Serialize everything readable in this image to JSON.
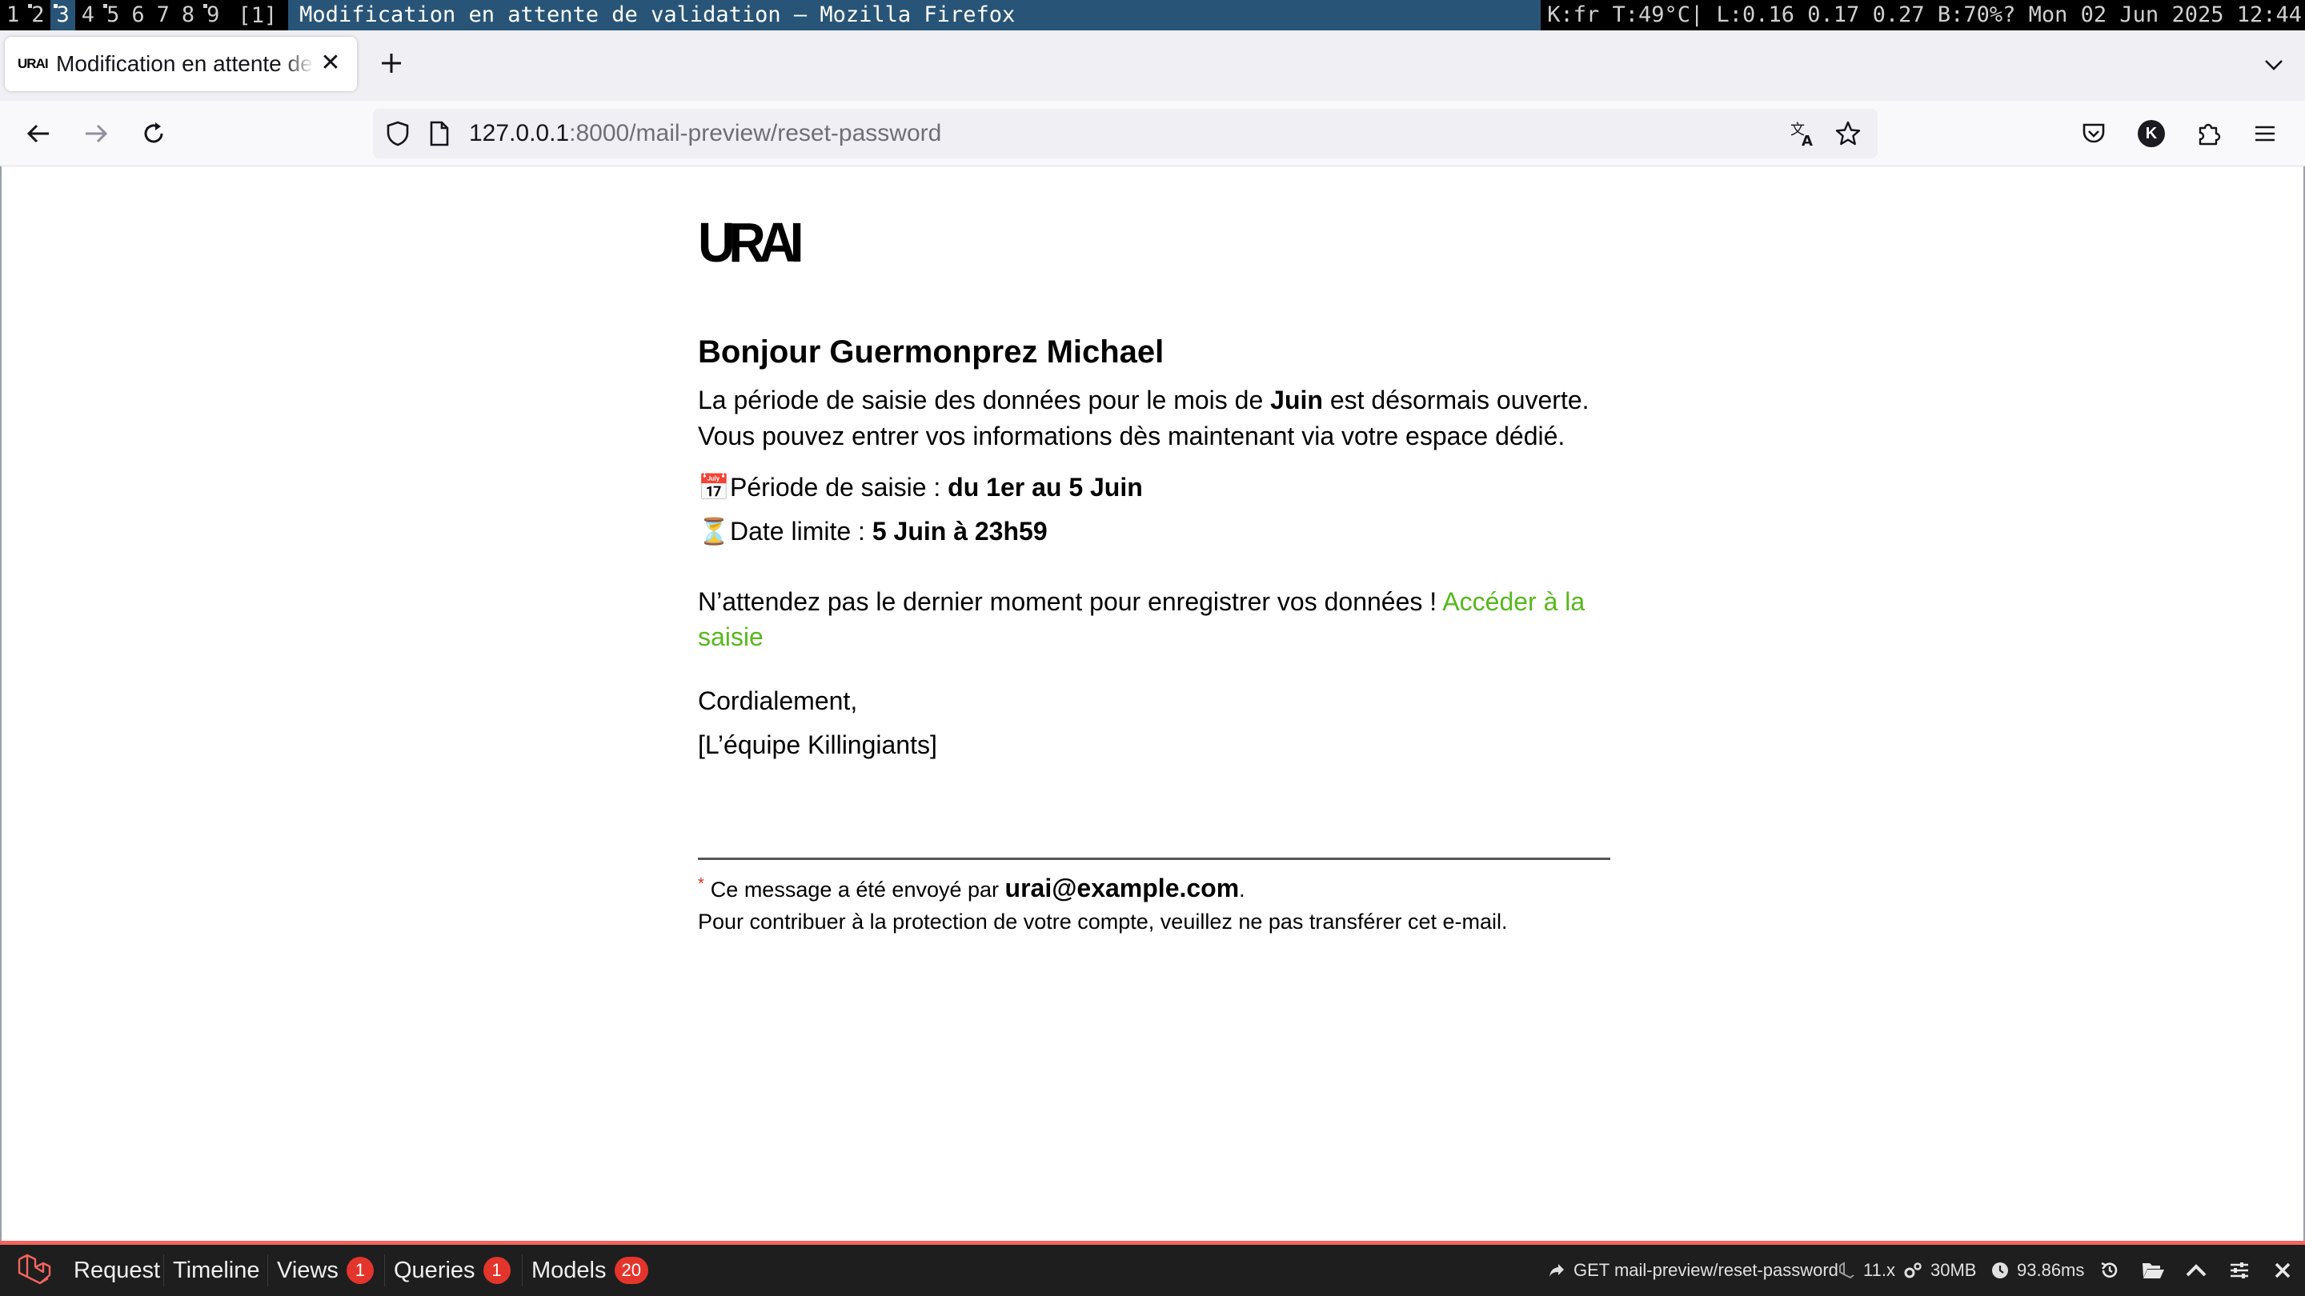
{
  "wm": {
    "workspaces": [
      {
        "label": "1",
        "sup": false,
        "active": false
      },
      {
        "label": "2",
        "sup": true,
        "active": false
      },
      {
        "label": "3",
        "sup": true,
        "active": true
      },
      {
        "label": "4",
        "sup": false,
        "active": false
      },
      {
        "label": "5",
        "sup": true,
        "active": false
      },
      {
        "label": "6",
        "sup": false,
        "active": false
      },
      {
        "label": "7",
        "sup": false,
        "active": false
      },
      {
        "label": "8",
        "sup": false,
        "active": false
      },
      {
        "label": "9",
        "sup": true,
        "active": false
      }
    ],
    "count": "[1]",
    "window_title": "Modification en attente de validation — Mozilla Firefox",
    "status": "K:fr T:49°C| L:0.16 0.17 0.27 B:70%? Mon 02 Jun 2025 12:44"
  },
  "browser": {
    "tab": {
      "favicon_text": "URAI",
      "title": "Modification en attente de validation"
    },
    "url": {
      "host": "127.0.0.1",
      "rest": ":8000/mail-preview/reset-password"
    },
    "account_initial": "K"
  },
  "mail": {
    "logo": "URAI",
    "greeting": "Bonjour Guermonprez Michael",
    "intro_part1": "La période de saisie des données pour le mois de ",
    "intro_month": "Juin",
    "intro_part2": " est désormais ouverte. Vous pouvez entrer vos informations dès maintenant via votre espace dédié.",
    "period_emoji": "📅",
    "period_label": "Période de saisie : ",
    "period_value": "du 1er au 5 Juin",
    "deadline_emoji": "⏳",
    "deadline_label": "Date limite : ",
    "deadline_value": "5 Juin à 23h59",
    "cta_text": "N’attendez pas le dernier moment pour enregistrer vos données ! ",
    "cta_link": "Accéder à la saisie",
    "closing": "Cordialement,",
    "signature": "[L’équipe Killingiants]",
    "footer_star": "*",
    "footer_sent": "Ce message a été envoyé par ",
    "footer_email": "urai@example.com",
    "footer_period": ".",
    "footer_notice": "Pour contribuer à la protection de votre compte, veuillez ne pas transférer cet e-mail."
  },
  "debugbar": {
    "tabs": [
      {
        "label": "Request",
        "badge": null
      },
      {
        "label": "Timeline",
        "badge": null
      },
      {
        "label": "Views",
        "badge": "1"
      },
      {
        "label": "Queries",
        "badge": "1"
      },
      {
        "label": "Models",
        "badge": "20"
      }
    ],
    "route": "GET mail-preview/reset-password",
    "version": "11.x",
    "memory": "30MB",
    "duration": "93.86ms",
    "accent_color": "#f4645f"
  }
}
